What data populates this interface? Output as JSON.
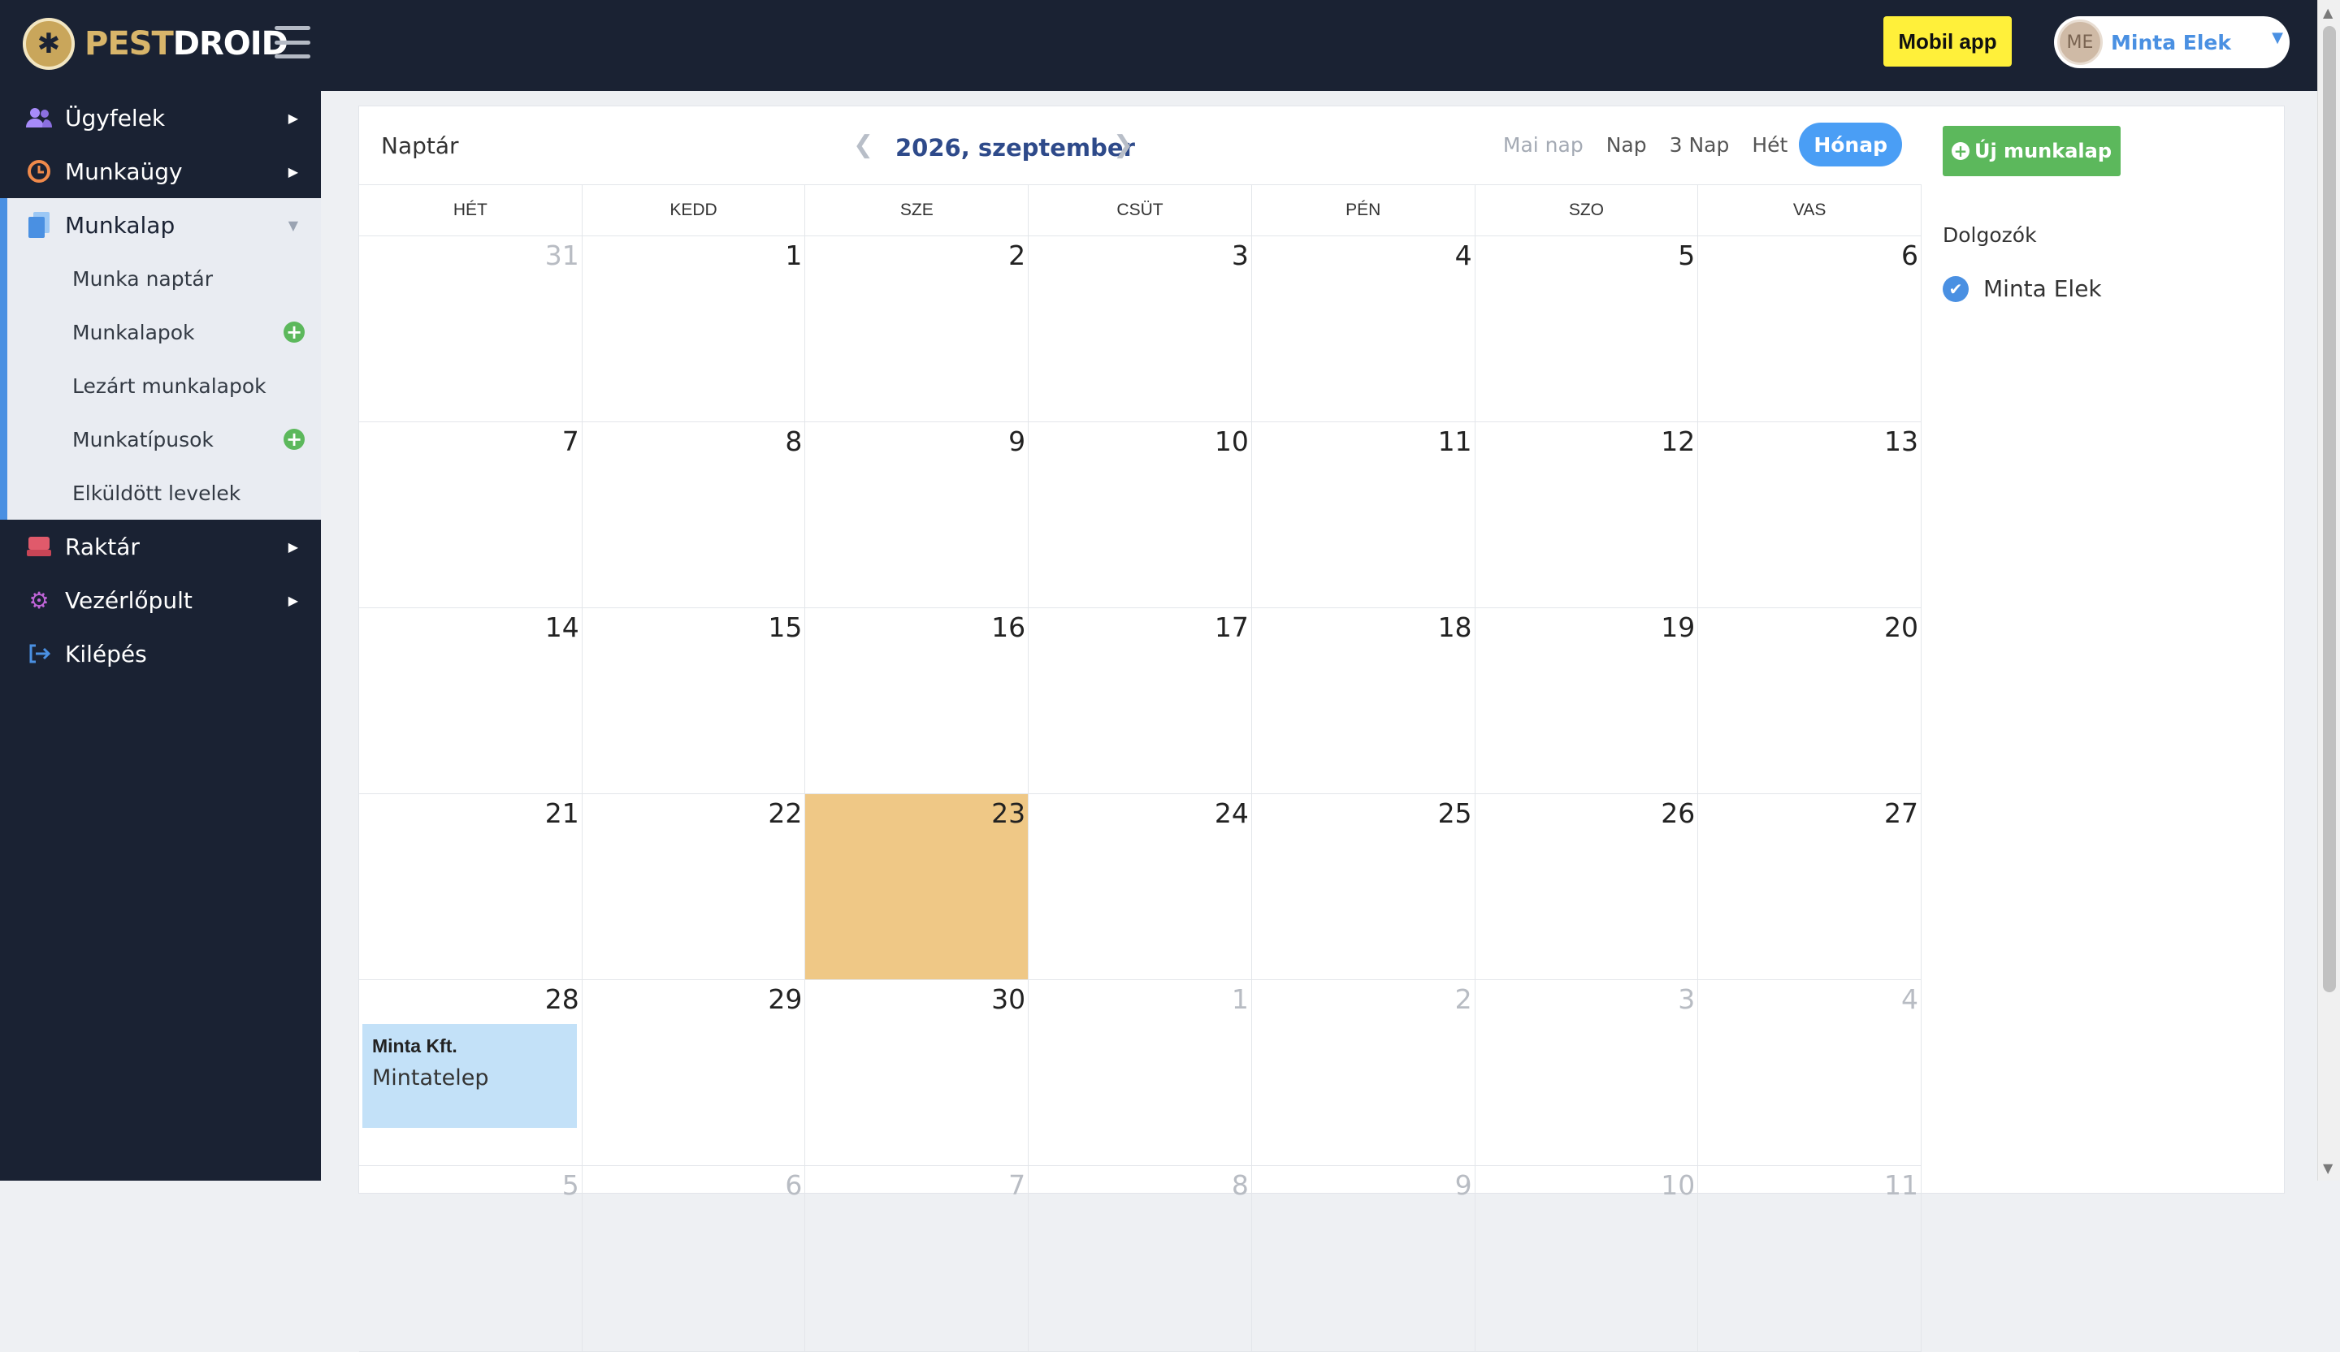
{
  "brand": {
    "name_part1": "PEST",
    "name_part2": "DROID"
  },
  "header": {
    "mobil_app_label": "Mobil app",
    "user": {
      "initials": "ME",
      "name": "Minta Elek"
    }
  },
  "sidebar": {
    "items": [
      {
        "label": "Ügyfelek",
        "icon": "users-icon"
      },
      {
        "label": "Munkaügy",
        "icon": "clock-icon"
      },
      {
        "label": "Munkalap",
        "icon": "documents-icon",
        "active": true
      },
      {
        "label": "Raktár",
        "icon": "warehouse-icon"
      },
      {
        "label": "Vezérlőpult",
        "icon": "gear-icon"
      },
      {
        "label": "Kilépés",
        "icon": "logout-icon"
      }
    ],
    "submenu": [
      {
        "label": "Munka naptár"
      },
      {
        "label": "Munkalapok",
        "plus": true
      },
      {
        "label": "Lezárt munkalapok"
      },
      {
        "label": "Munkatípusok",
        "plus": true
      },
      {
        "label": "Elküldött levelek"
      }
    ]
  },
  "calendar": {
    "title": "Naptár",
    "month": "2026, szeptember",
    "views": [
      "Mai nap",
      "Nap",
      "3 Nap",
      "Hét",
      "Hónap"
    ],
    "active_view": "Hónap",
    "weekdays": [
      "HÉT",
      "KEDD",
      "SZE",
      "CSÜT",
      "PÉN",
      "SZO",
      "VAS"
    ],
    "weeks": [
      [
        {
          "d": "31",
          "other": true
        },
        {
          "d": "1"
        },
        {
          "d": "2"
        },
        {
          "d": "3"
        },
        {
          "d": "4"
        },
        {
          "d": "5"
        },
        {
          "d": "6"
        }
      ],
      [
        {
          "d": "7"
        },
        {
          "d": "8"
        },
        {
          "d": "9"
        },
        {
          "d": "10"
        },
        {
          "d": "11"
        },
        {
          "d": "12"
        },
        {
          "d": "13"
        }
      ],
      [
        {
          "d": "14"
        },
        {
          "d": "15"
        },
        {
          "d": "16"
        },
        {
          "d": "17"
        },
        {
          "d": "18"
        },
        {
          "d": "19"
        },
        {
          "d": "20"
        }
      ],
      [
        {
          "d": "21"
        },
        {
          "d": "22"
        },
        {
          "d": "23",
          "today": true
        },
        {
          "d": "24"
        },
        {
          "d": "25"
        },
        {
          "d": "26"
        },
        {
          "d": "27"
        }
      ],
      [
        {
          "d": "28",
          "event": {
            "title": "Minta Kft.",
            "sub": "Mintatelep"
          }
        },
        {
          "d": "29"
        },
        {
          "d": "30"
        },
        {
          "d": "1",
          "other": true
        },
        {
          "d": "2",
          "other": true
        },
        {
          "d": "3",
          "other": true
        },
        {
          "d": "4",
          "other": true
        }
      ],
      [
        {
          "d": "5",
          "other": true
        },
        {
          "d": "6",
          "other": true
        },
        {
          "d": "7",
          "other": true
        },
        {
          "d": "8",
          "other": true
        },
        {
          "d": "9",
          "other": true
        },
        {
          "d": "10",
          "other": true
        },
        {
          "d": "11",
          "other": true
        }
      ]
    ]
  },
  "panel": {
    "new_button": "Új munkalap",
    "workers_title": "Dolgozók",
    "workers": [
      {
        "name": "Minta Elek",
        "checked": true
      }
    ]
  },
  "colors": {
    "sidebar_bg": "#1a2233",
    "accent_blue": "#4a90e2",
    "today_bg": "#efc886",
    "event_bg": "#c3e1f8",
    "new_button": "#5cb85c",
    "mobil_app": "#fff03a"
  }
}
